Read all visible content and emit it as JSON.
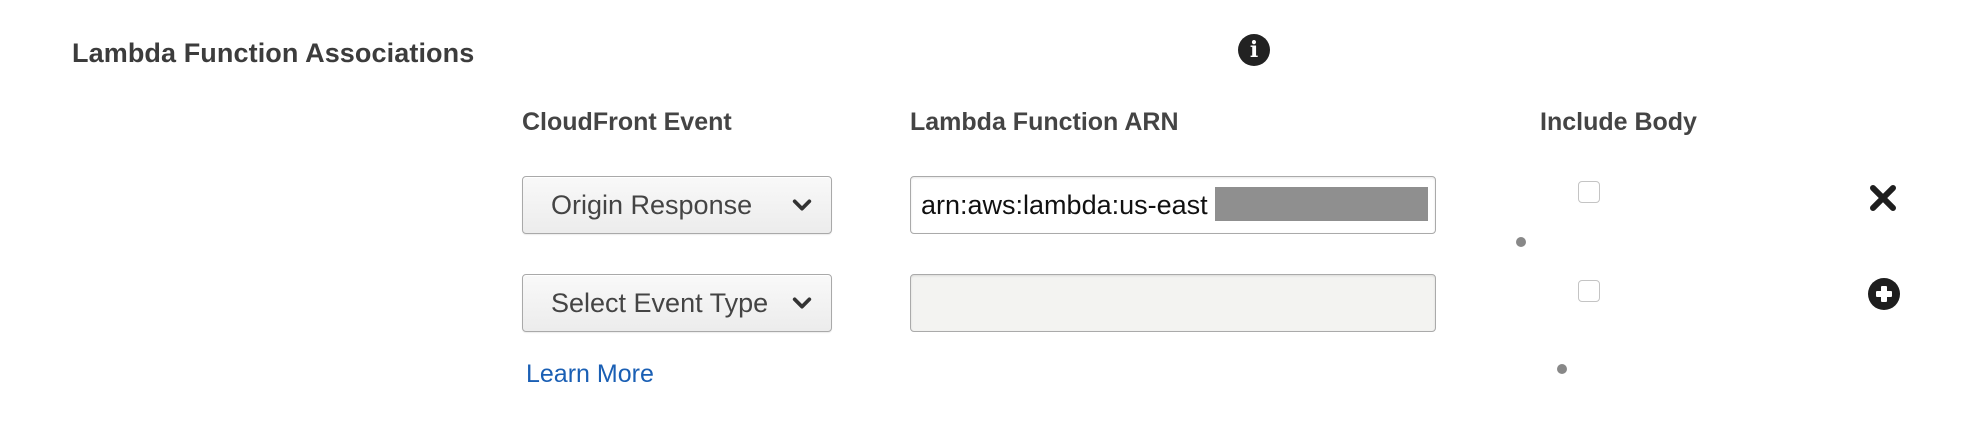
{
  "section": {
    "title": "Lambda Function Associations",
    "info_icon": "info-circle-icon"
  },
  "columns": {
    "event": "CloudFront Event",
    "arn": "Lambda Function ARN",
    "include_body": "Include Body"
  },
  "rows": [
    {
      "event_value": "Origin Response",
      "arn_value": "arn:aws:lambda:us-east",
      "arn_redacted": true,
      "include_body_checked": false,
      "action_icon": "close-icon"
    },
    {
      "event_value": "Select Event Type",
      "arn_value": "",
      "include_body_checked": false,
      "action_icon": "add-circle-icon"
    }
  ],
  "links": {
    "learn_more": "Learn More"
  },
  "colors": {
    "link": "#1a5fb4",
    "redaction": "#8f8f8f",
    "icon": "#222222"
  }
}
